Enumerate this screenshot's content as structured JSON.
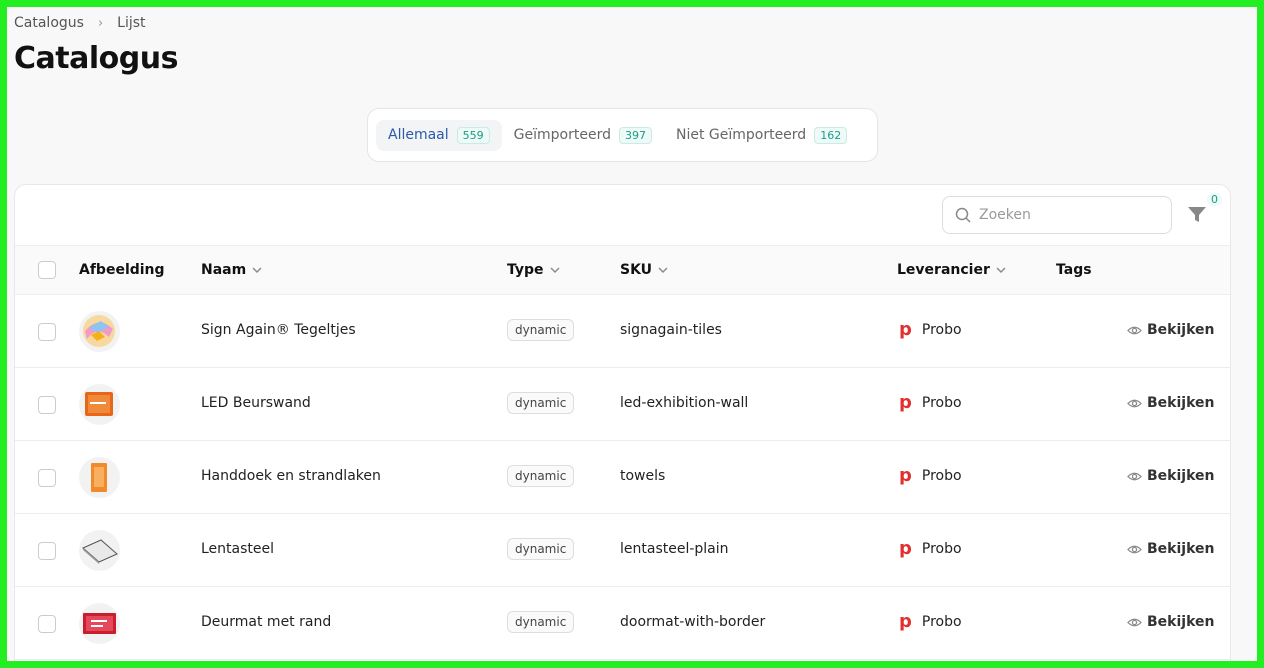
{
  "breadcrumb": {
    "items": [
      "Catalogus",
      "Lijst"
    ]
  },
  "page": {
    "title": "Catalogus"
  },
  "tabs": [
    {
      "label": "Allemaal",
      "count": "559",
      "active": true
    },
    {
      "label": "Geïmporteerd",
      "count": "397"
    },
    {
      "label": "Niet Geïmporteerd",
      "count": "162"
    }
  ],
  "toolbar": {
    "search_placeholder": "Zoeken",
    "filter_count": "0"
  },
  "table": {
    "headers": {
      "image": "Afbeelding",
      "name": "Naam",
      "type": "Type",
      "sku": "SKU",
      "supplier": "Leverancier",
      "tags": "Tags"
    },
    "view_label": "Bekijken",
    "rows": [
      {
        "name": "Sign Again® Tegeltjes",
        "type": "dynamic",
        "sku": "signagain-tiles",
        "supplier": "Probo"
      },
      {
        "name": "LED Beurswand",
        "type": "dynamic",
        "sku": "led-exhibition-wall",
        "supplier": "Probo"
      },
      {
        "name": "Handdoek en strandlaken",
        "type": "dynamic",
        "sku": "towels",
        "supplier": "Probo"
      },
      {
        "name": "Lentasteel",
        "type": "dynamic",
        "sku": "lentasteel-plain",
        "supplier": "Probo"
      },
      {
        "name": "Deurmat met rand",
        "type": "dynamic",
        "sku": "doormat-with-border",
        "supplier": "Probo"
      }
    ]
  },
  "colors": {
    "accent": "#2a5aa8",
    "count": "#1a9a8a",
    "brand_red": "#e23030",
    "frame": "#22ee22"
  }
}
